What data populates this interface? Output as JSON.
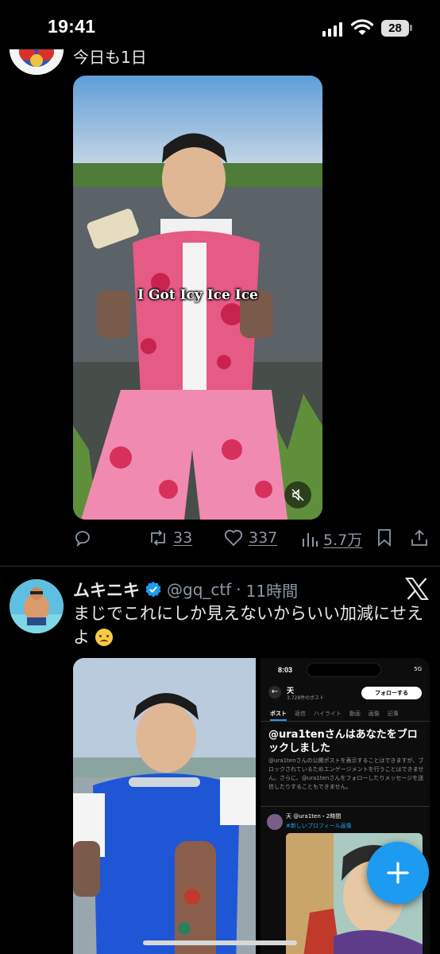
{
  "status_bar": {
    "time": "19:41",
    "battery": "28"
  },
  "previous_tweet": {
    "text_fragment": "今日も1日",
    "video_subtitle": "I Got Icy Ice Ice",
    "actions": {
      "reply_icon": "reply-icon",
      "retweet_count": "33",
      "like_count": "337",
      "views_count": "5.7万"
    }
  },
  "tweet": {
    "name": "ムキニキ",
    "handle": "@gq_ctf",
    "separator": "·",
    "time_ago": "11時間",
    "text": "まじでこれにしか見えないからいい加減にせえよ",
    "emoji": "crying-face"
  },
  "embedded_screenshot": {
    "time": "8:03",
    "status": "5G",
    "profile_name": "天",
    "post_count": "3,728件のポスト",
    "follow_label": "フォローする",
    "tabs": [
      "ポスト",
      "返信",
      "ハイライト",
      "動画",
      "画像",
      "記事"
    ],
    "block_title": "@ura1tenさんはあなたをブロックしました",
    "block_body": "@ura1tenさんの公開ポストを表示することはできますが、ブロックされているためエンゲージメントを行うことはできません。さらに、@ura1tenさんをフォローしたりメッセージを送信したりすることもできません。",
    "post_header": "天 @ura1ten・2時間",
    "post_tag": "#新しいプロフィール画像"
  },
  "colors": {
    "accent": "#1d9bf0",
    "background": "#000000",
    "secondary_text": "#8b98a5",
    "primary_text": "#e7e9ea"
  }
}
